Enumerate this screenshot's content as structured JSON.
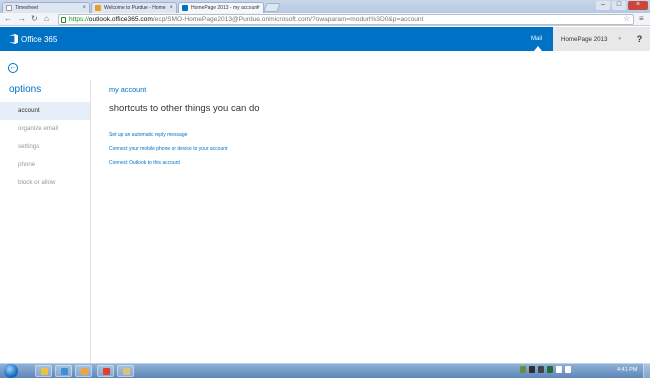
{
  "browser": {
    "tabs": [
      {
        "title": "Timesheet",
        "favicon": "document-icon",
        "color": "#ffffff",
        "active": false
      },
      {
        "title": "Welcome to Purdue - Home",
        "favicon": "purdue-icon",
        "color": "#e8a020",
        "active": false
      },
      {
        "title": "HomePage 2013 - my account",
        "favicon": "office365-icon",
        "color": "#0072c6",
        "active": true
      }
    ],
    "tab_close": "×",
    "window_controls": {
      "minimize": "–",
      "maximize": "□",
      "close": "×"
    },
    "url": {
      "scheme": "https://",
      "domain": "outlook.office365.com",
      "path": "/ecp/SMO-HomePage2013@Purdue.onmicrosoft.com/?owaparam=modurl%3D0&p=account"
    },
    "nav": {
      "back": "←",
      "forward": "→",
      "reload": "↻",
      "home": "⌂",
      "star": "☆",
      "menu": "≡"
    }
  },
  "header": {
    "brand": "Office 365",
    "mail_link": "Mail",
    "user_tile": "HomePage 2013",
    "user_caret": "▾",
    "help": "?"
  },
  "sidebar": {
    "back_icon": "←",
    "title": "options",
    "items": [
      {
        "label": "account",
        "active": true
      },
      {
        "label": "organize email",
        "active": false
      },
      {
        "label": "settings",
        "active": false
      },
      {
        "label": "phone",
        "active": false
      },
      {
        "label": "block or allow",
        "active": false
      }
    ]
  },
  "main": {
    "section_title": "my account",
    "heading": "shortcuts to other things you can do",
    "links": [
      "Set up an automatic reply message",
      "Connect your mobile phone or device to your account",
      "Connect Outlook to this account"
    ]
  },
  "taskbar": {
    "clock": "4:41 PM",
    "apps": [
      {
        "name": "explorer",
        "color": "#f0c040"
      },
      {
        "name": "ie",
        "color": "#3a8fd8"
      },
      {
        "name": "outlook",
        "color": "#f2a43c"
      },
      {
        "name": "chrome",
        "color": "#e04030"
      },
      {
        "name": "folder",
        "color": "#d9c27a"
      }
    ],
    "tray_colors": [
      "#6c8c3c",
      "#2f2f2f",
      "#444444",
      "#2c6a2c",
      "#ffffff",
      "#ffffff"
    ]
  },
  "colors": {
    "brand_blue": "#0072c6",
    "sidebar_active": "#e6eff8"
  }
}
